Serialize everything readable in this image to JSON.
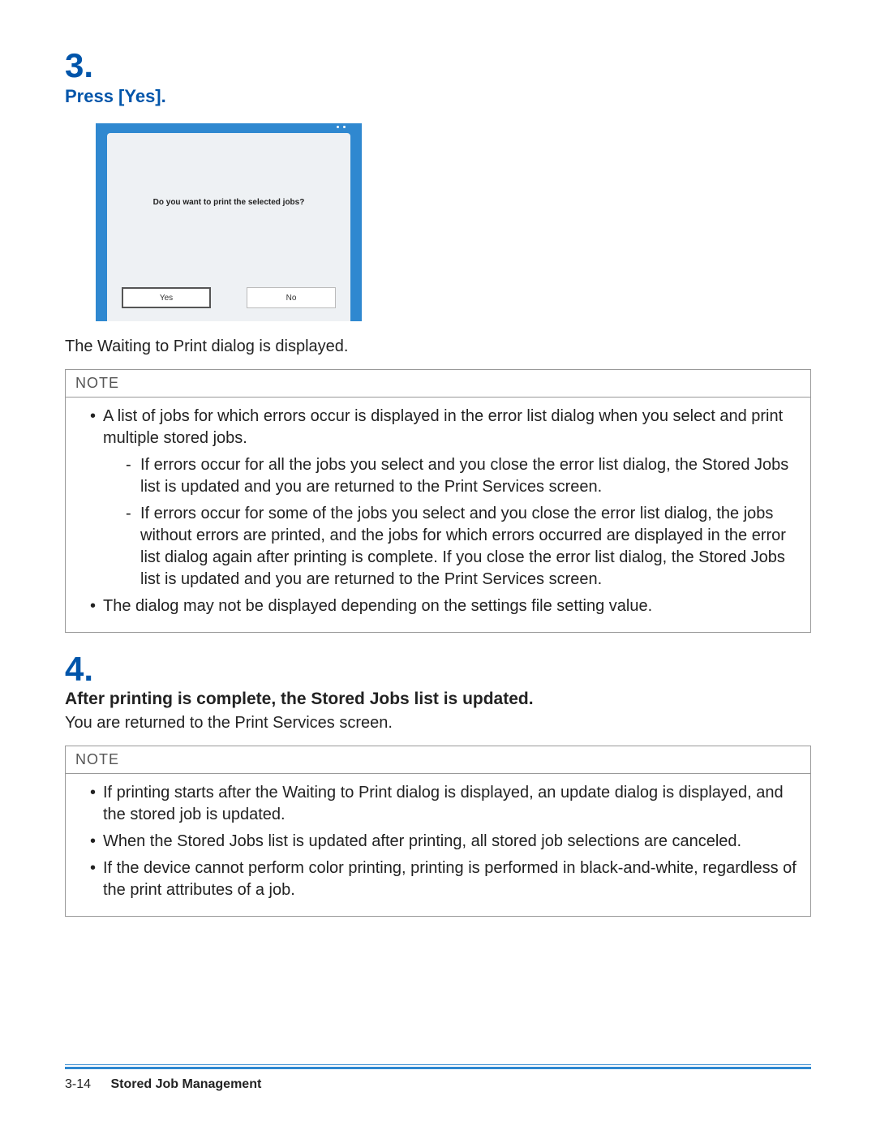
{
  "step3": {
    "number": "3.",
    "title": "Press [Yes].",
    "dialog_text": "Do you want to print the selected jobs?",
    "btn_yes": "Yes",
    "btn_no": "No",
    "after_text": "The Waiting to Print dialog is displayed."
  },
  "note1": {
    "heading": "NOTE",
    "items": {
      "0": {
        "text": "A list of jobs for which errors occur is displayed in the error list dialog when you select and print multiple stored jobs.",
        "sub": {
          "0": "If errors occur for all the jobs you select and you close the error list dialog, the Stored Jobs list is updated and you are returned to the Print Services screen.",
          "1": "If errors occur for some of the jobs you select and you close the error list dialog, the jobs without errors are printed, and the jobs for which errors occurred are displayed in the error list dialog again after printing is complete. If you close the error list dialog, the Stored Jobs list is updated and you are returned to the Print Services screen."
        }
      },
      "1": {
        "text": "The dialog may not be displayed depending on the settings file setting value."
      }
    }
  },
  "step4": {
    "number": "4.",
    "title": "After printing is complete, the Stored Jobs list is updated.",
    "body": "You are returned to the Print Services screen."
  },
  "note2": {
    "heading": "NOTE",
    "items": {
      "0": "If printing starts after the Waiting to Print dialog is displayed, an update dialog is displayed, and the stored job is updated.",
      "1": "When the Stored Jobs list is updated after printing, all stored job selections are canceled.",
      "2": "If the device cannot perform color printing, printing is performed in black-and-white, regardless of the print attributes of a job."
    }
  },
  "footer": {
    "page": "3-14",
    "section": "Stored Job Management"
  }
}
